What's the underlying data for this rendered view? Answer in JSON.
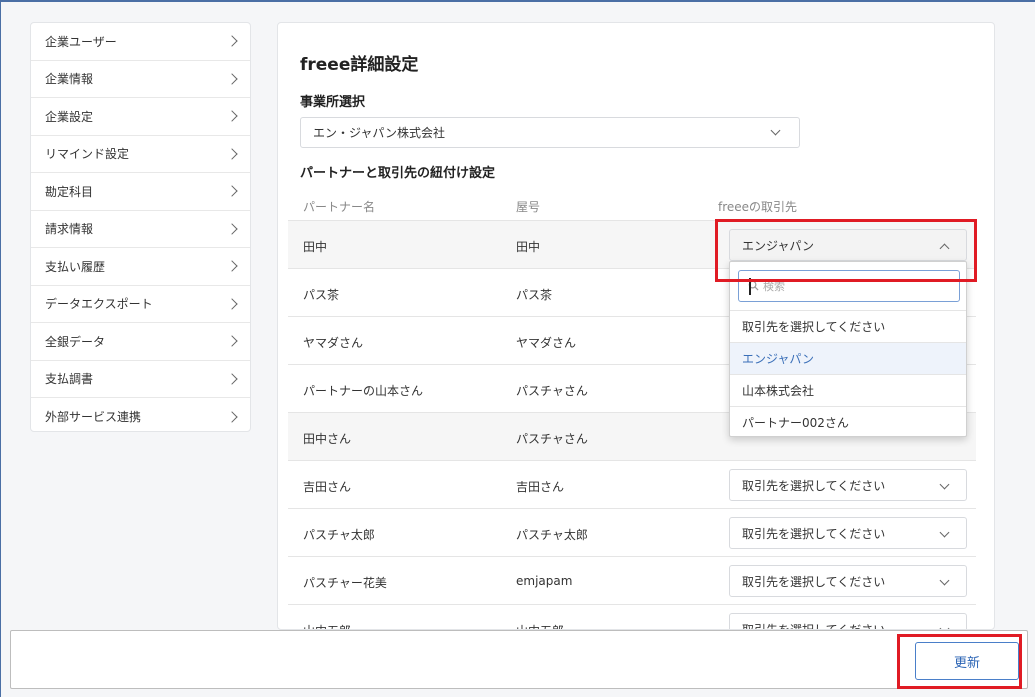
{
  "sidebar": {
    "items": [
      {
        "label": "企業ユーザー"
      },
      {
        "label": "企業情報"
      },
      {
        "label": "企業設定"
      },
      {
        "label": "リマインド設定"
      },
      {
        "label": "勘定科目"
      },
      {
        "label": "請求情報"
      },
      {
        "label": "支払い履歴"
      },
      {
        "label": "データエクスポート"
      },
      {
        "label": "全銀データ"
      },
      {
        "label": "支払調書"
      },
      {
        "label": "外部サービス連携"
      }
    ]
  },
  "main": {
    "title": "freee詳細設定",
    "office_label": "事業所選択",
    "office_value": "エン・ジャパン株式会社",
    "mapping_label": "パートナーと取引先の紐付け設定",
    "columns": [
      "パートナー名",
      "屋号",
      "freeeの取引先"
    ],
    "rows": [
      {
        "partner": "田中",
        "trade_name": "田中",
        "freee": "エンジャパン"
      },
      {
        "partner": "パス茶",
        "trade_name": "パス茶",
        "freee": ""
      },
      {
        "partner": "ヤマダさん",
        "trade_name": "ヤマダさん",
        "freee": ""
      },
      {
        "partner": "パートナーの山本さん",
        "trade_name": "パスチャさん",
        "freee": ""
      },
      {
        "partner": "田中さん",
        "trade_name": "パスチャさん",
        "freee": ""
      },
      {
        "partner": "吉田さん",
        "trade_name": "吉田さん",
        "freee": "取引先を選択してください"
      },
      {
        "partner": "パスチャ太郎",
        "trade_name": "パスチャ太郎",
        "freee": "取引先を選択してください"
      },
      {
        "partner": "パスチャー花美",
        "trade_name": "emjapam",
        "freee": "取引先を選択してください"
      },
      {
        "partner": "山内五郎",
        "trade_name": "山内五郎",
        "freee": "取引先を選択してください"
      }
    ]
  },
  "dropdown": {
    "search_placeholder": "検索",
    "options": [
      "取引先を選択してください",
      "エンジャパン",
      "山本株式会社",
      "パートナー002さん"
    ],
    "selected": "エンジャパン"
  },
  "footer": {
    "update_label": "更新"
  },
  "colors": {
    "highlight": "#e01b24",
    "accent": "#2b64b5",
    "selected_bg": "#eef3fb"
  }
}
